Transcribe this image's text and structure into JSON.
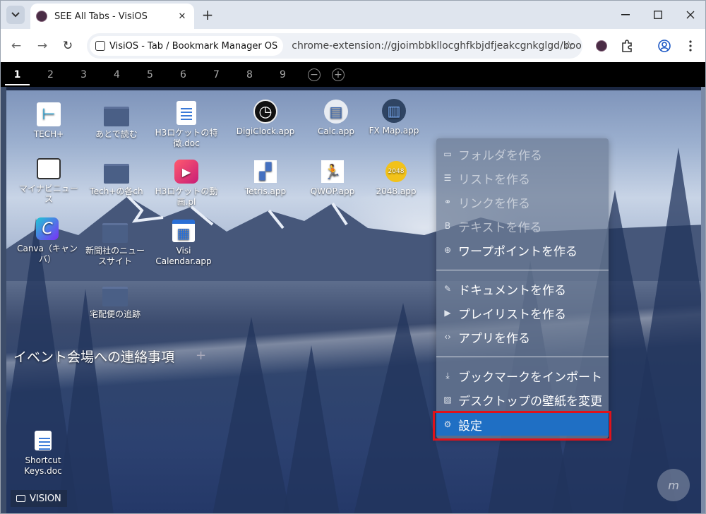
{
  "browser": {
    "tab_title": "SEE All Tabs - VisiOS",
    "site_chip": "VisiOS - Tab / Bookmark Manager OS",
    "url": "chrome-extension://gjoimbbkllocghfkbjdfjeakcgnkglgd/bookma..."
  },
  "pages": [
    "1",
    "2",
    "3",
    "4",
    "5",
    "6",
    "7",
    "8",
    "9"
  ],
  "page_controls": {
    "remove": "−",
    "add": "+"
  },
  "desktop_icons": [
    {
      "label": "TECH+"
    },
    {
      "label": "あとで読む"
    },
    {
      "label": "H3ロケットの特徴.doc"
    },
    {
      "label": "DigiClock.app"
    },
    {
      "label": "Calc.app"
    },
    {
      "label": "FX Map.app"
    },
    {
      "label": "マイナビニュース"
    },
    {
      "label": "Tech+の各ch"
    },
    {
      "label": "H3ロケットの動画.pl"
    },
    {
      "label": "Tetris.app"
    },
    {
      "label": "QWOP.app"
    },
    {
      "label": "2048.app"
    },
    {
      "label": "Canva（キャンバ）"
    },
    {
      "label": "新聞社のニュースサイト"
    },
    {
      "label": "Visi Calendar.app"
    },
    {
      "label": "宅配便の追跡"
    },
    {
      "label": "Shortcut Keys.doc"
    }
  ],
  "icon_glyphs": {
    "tech": "⊢",
    "canva": "C",
    "calendar": "▦",
    "calc": "▤",
    "clock": "◷",
    "fxmap": "▥",
    "game2048": "2048",
    "video": "▶",
    "tetris": "▞",
    "qwop": "🏃"
  },
  "section": {
    "title": "イベント会場への連絡事項",
    "add": "+"
  },
  "context_menu": {
    "items": [
      {
        "label": "フォルダを作る",
        "icon": "folder-icon",
        "glyph": "▭"
      },
      {
        "label": "リストを作る",
        "icon": "list-icon",
        "glyph": "☰"
      },
      {
        "label": "リンクを作る",
        "icon": "link-icon",
        "glyph": "⚭"
      },
      {
        "label": "テキストを作る",
        "icon": "bold-icon",
        "glyph": "B"
      },
      {
        "label": "ワープポイントを作る",
        "icon": "globe-icon",
        "glyph": "⊕"
      },
      {
        "label": "ドキュメントを作る",
        "icon": "edit-icon",
        "glyph": "✎"
      },
      {
        "label": "プレイリストを作る",
        "icon": "play-icon",
        "glyph": "▶"
      },
      {
        "label": "アプリを作る",
        "icon": "code-icon",
        "glyph": "‹›"
      },
      {
        "label": "ブックマークをインポート",
        "icon": "download-icon",
        "glyph": "⤓"
      },
      {
        "label": "デスクトップの壁紙を変更",
        "icon": "image-icon",
        "glyph": "▨"
      },
      {
        "label": "設定",
        "icon": "sliders-icon",
        "glyph": "⚙"
      }
    ]
  },
  "taskbar": {
    "label": "VISION"
  },
  "avatar_text": "m"
}
